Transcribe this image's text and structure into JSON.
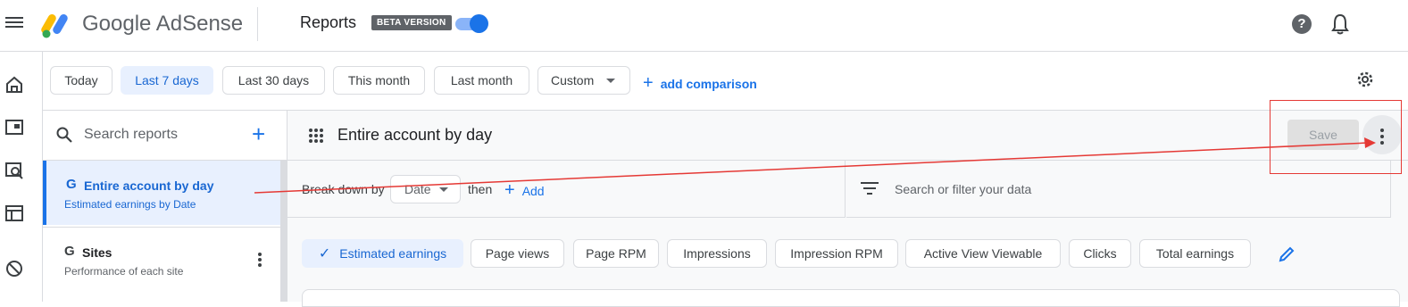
{
  "header": {
    "brand": "Google AdSense",
    "page_title": "Reports",
    "beta_label": "BETA VERSION",
    "beta_toggle_on": true
  },
  "date_range": {
    "chips": [
      "Today",
      "Last 7 days",
      "Last 30 days",
      "This month",
      "Last month"
    ],
    "selected": "Last 7 days",
    "custom_label": "Custom",
    "add_comparison": "add comparison"
  },
  "sidebar": {
    "search_placeholder": "Search reports",
    "reports": [
      {
        "icon": "G",
        "title": "Entire account by day",
        "subtitle": "Estimated earnings by Date"
      },
      {
        "icon": "G",
        "title": "Sites",
        "subtitle": "Performance of each site"
      }
    ]
  },
  "report": {
    "title": "Entire account by day",
    "save_label": "Save",
    "breakdown_label": "Break down by",
    "breakdown_value": "Date",
    "then_label": "then",
    "add_label": "Add",
    "filter_placeholder": "Search or filter your data",
    "metrics": [
      "Estimated earnings",
      "Page views",
      "Page RPM",
      "Impressions",
      "Impression RPM",
      "Active View Viewable",
      "Clicks",
      "Total earnings"
    ],
    "selected_metric": "Estimated earnings"
  },
  "colors": {
    "accent": "#1a73e8",
    "selected_bg": "#e8f0fe",
    "annotation": "#e53935"
  }
}
